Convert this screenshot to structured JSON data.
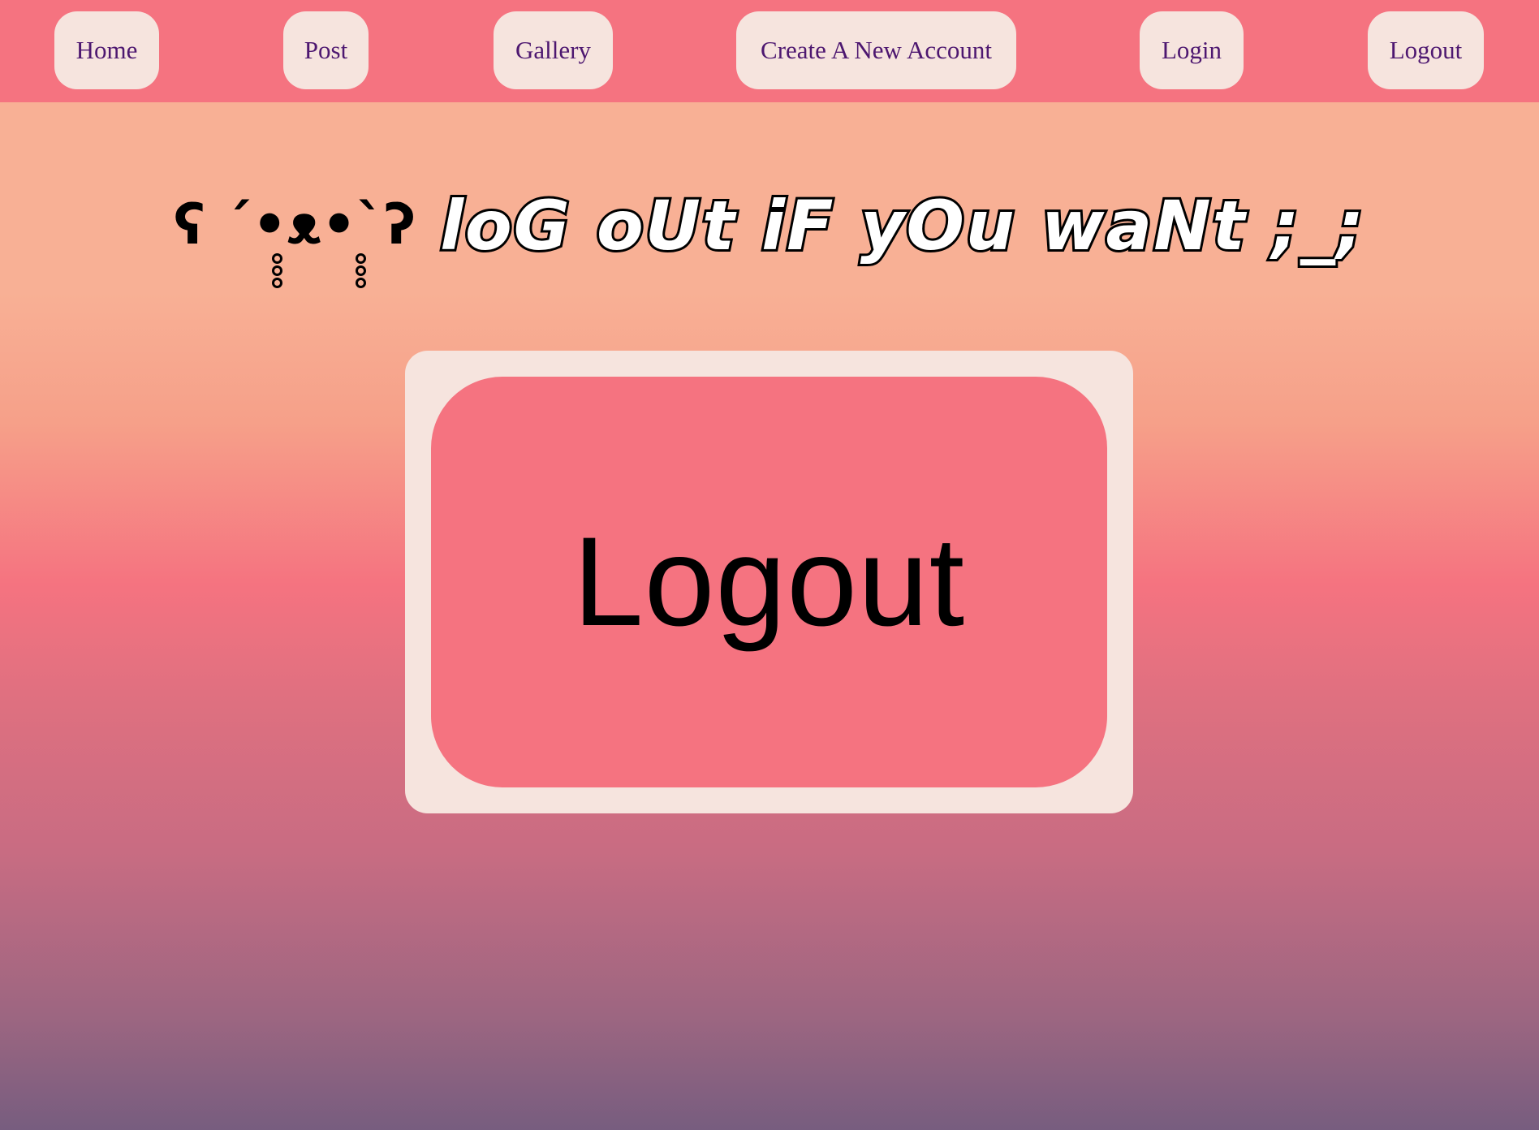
{
  "nav": {
    "items": [
      {
        "label": "Home"
      },
      {
        "label": "Post"
      },
      {
        "label": "Gallery"
      },
      {
        "label": "Create A New Account"
      },
      {
        "label": "Login"
      },
      {
        "label": "Logout"
      }
    ]
  },
  "hero": {
    "emoticon": "ʕ ´•ᴥ•`ʔ",
    "text": "loG oUt iF yOu waNt ;_;"
  },
  "card": {
    "button_label": "Logout"
  },
  "colors": {
    "navbar": "#f57380",
    "nav_button": "#f6e4de",
    "nav_text": "#4d1770",
    "card": "#f6e4de",
    "big_button": "#f57380"
  }
}
